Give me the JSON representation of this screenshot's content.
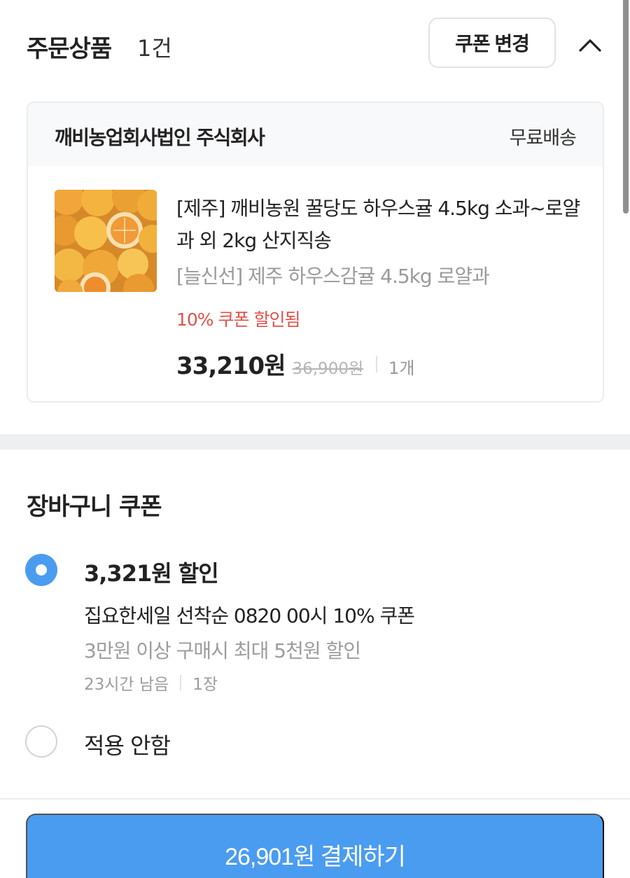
{
  "header": {
    "title": "주문상품",
    "count": "1건",
    "coupon_change_label": "쿠폰 변경",
    "collapse_icon": "chevron-up-icon"
  },
  "order": {
    "seller": "깨비농업회사법인 주식회사",
    "shipping": "무료배송",
    "product": {
      "image_icon": "tangerine-product-photo",
      "name": "[제주] 깨비농원 꿀당도 하우스귤 4.5kg 소과~로얄과 외 2kg 산지직송",
      "option": "[늘신선] 제주 하우스감귤 4.5kg 로얄과",
      "discount_note": "10% 쿠폰 할인됨",
      "price": "33,210원",
      "original_price": "36,900원",
      "quantity": "1개"
    }
  },
  "cart_coupon": {
    "title": "장바구니 쿠폰",
    "options": [
      {
        "selected": true,
        "amount": "3,321원 할인",
        "name": "집요한세일 선착순 0820 00시 10% 쿠폰",
        "condition": "3만원 이상 구매시 최대 5천원 할인",
        "remaining": "23시간 남음",
        "count": "1장"
      },
      {
        "selected": false,
        "label": "적용 안함"
      }
    ]
  },
  "checkout": {
    "pay_label": "26,901원 결제하기"
  },
  "colors": {
    "accent": "#4a9cf0",
    "discount": "#e0514c",
    "muted": "#9d9d9d",
    "card_header_bg": "#f8f9fb"
  }
}
